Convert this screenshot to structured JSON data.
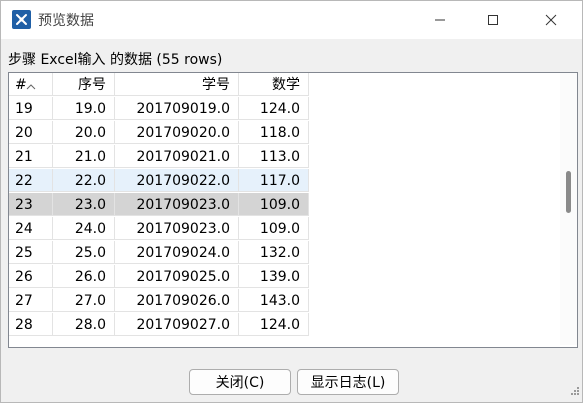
{
  "window": {
    "title": "预览数据"
  },
  "subtitle": "步骤 Excel输入 的数据  (55 rows)",
  "table": {
    "columns": [
      "#",
      "序号",
      "学号",
      "数学"
    ],
    "rows": [
      [
        "19",
        "19.0",
        "201709019.0",
        "124.0"
      ],
      [
        "20",
        "20.0",
        "201709020.0",
        "118.0"
      ],
      [
        "21",
        "21.0",
        "201709021.0",
        "113.0"
      ],
      [
        "22",
        "22.0",
        "201709022.0",
        "117.0"
      ],
      [
        "23",
        "23.0",
        "201709023.0",
        "109.0"
      ],
      [
        "24",
        "24.0",
        "201709023.0",
        "109.0"
      ],
      [
        "25",
        "25.0",
        "201709024.0",
        "132.0"
      ],
      [
        "26",
        "26.0",
        "201709025.0",
        "139.0"
      ],
      [
        "27",
        "27.0",
        "201709026.0",
        "143.0"
      ],
      [
        "28",
        "28.0",
        "201709027.0",
        "124.0"
      ]
    ]
  },
  "buttons": {
    "close": "关闭(C)",
    "log": "显示日志(L)"
  },
  "colors": {
    "accent": "#1f5fa6",
    "hover_row": "#e6f1fb",
    "selected_row": "#d4d4d4"
  },
  "icons": [
    "app-icon",
    "minimize-icon",
    "maximize-icon",
    "close-icon",
    "sort-up-icon",
    "resize-grip-icon"
  ]
}
